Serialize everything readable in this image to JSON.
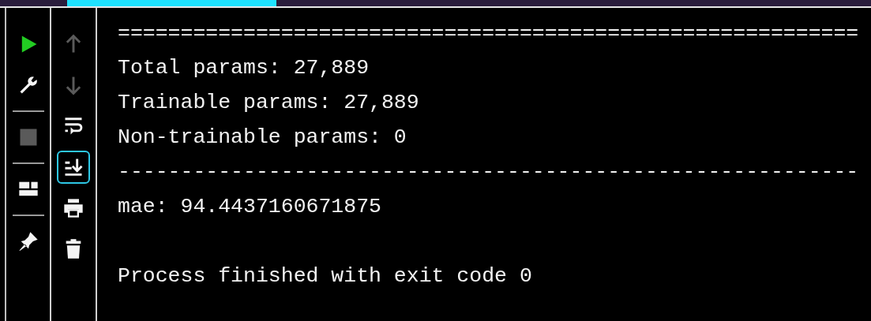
{
  "left_toolbar": [
    {
      "kind": "run",
      "disabled": false
    },
    {
      "kind": "settings",
      "disabled": false
    },
    {
      "kind": "separator"
    },
    {
      "kind": "stop",
      "disabled": true
    },
    {
      "kind": "separator"
    },
    {
      "kind": "layout",
      "disabled": false
    },
    {
      "kind": "separator"
    },
    {
      "kind": "pin",
      "disabled": false
    }
  ],
  "console_toolbar": [
    {
      "kind": "up",
      "disabled": true,
      "selected": false
    },
    {
      "kind": "down",
      "disabled": true,
      "selected": false
    },
    {
      "kind": "wrap",
      "disabled": false,
      "selected": false
    },
    {
      "kind": "scroll_end",
      "disabled": false,
      "selected": true
    },
    {
      "kind": "print",
      "disabled": false,
      "selected": false
    },
    {
      "kind": "trash",
      "disabled": false,
      "selected": false
    }
  ],
  "console_lines": [
    "===========================================================",
    "Total params: 27,889",
    "Trainable params: 27,889",
    "Non-trainable params: 0",
    "-----------------------------------------------------------",
    "mae: 94.4437160671875"
  ],
  "exit_message": "Process finished with exit code 0"
}
